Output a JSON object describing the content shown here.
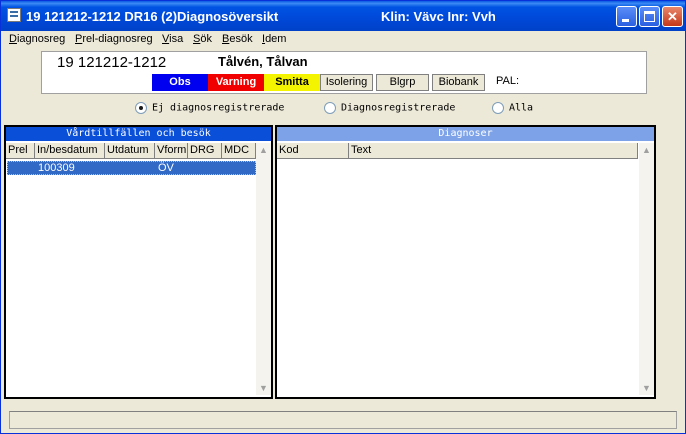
{
  "window": {
    "title": "19 121212-1212   DR16 (2)Diagnosöversikt",
    "klin_inr": "Klin: Vävc  Inr: Vvh",
    "minimize_label": "",
    "close_label": "✕"
  },
  "menu": {
    "items": [
      {
        "first": "D",
        "rest": "iagnosreg"
      },
      {
        "first": "P",
        "rest": "rel-diagnosreg"
      },
      {
        "first": "V",
        "rest": "isa"
      },
      {
        "first": "S",
        "rest": "ök"
      },
      {
        "first": "B",
        "rest": "esök"
      },
      {
        "first": "I",
        "rest": "dem"
      }
    ]
  },
  "patient": {
    "personnummer": "19 121212-1212",
    "name": "Tålvén, Tålvan",
    "flags": {
      "obs": "Obs",
      "varning": "Varning",
      "smitta": "Smitta",
      "isolering": "Isolering",
      "blgrp": "Blgrp",
      "biobank": "Biobank"
    },
    "pal_label": "PAL:"
  },
  "filter": {
    "options": [
      {
        "label": "Ej diagnosregistrerade",
        "checked": true
      },
      {
        "label": "Diagnosregistrerade",
        "checked": false
      },
      {
        "label": "Alla",
        "checked": false
      }
    ]
  },
  "visits_panel": {
    "title": "Vårdtillfällen och besök",
    "columns": [
      "Prel",
      "In/besdatum",
      "Utdatum",
      "Vform",
      "DRG",
      "MDC"
    ],
    "rows": [
      {
        "prel": "",
        "in_besdatum": "100309",
        "utdatum": "",
        "vform": "ÖV",
        "drg": "",
        "mdc": ""
      }
    ]
  },
  "diagnoses_panel": {
    "title": "Diagnoser",
    "columns": [
      "Kod",
      "Text"
    ]
  },
  "scrollbar": {
    "up_icon": "▲",
    "down_icon": "▼"
  },
  "colors": {
    "titlebar": "#0054e3",
    "obs": "#0000f0",
    "varning": "#f00000",
    "smitta": "#f4f400",
    "selected_row": "#3169c6",
    "visits_header": "#0a4fd8",
    "diagnoses_header": "#7da2e8"
  }
}
